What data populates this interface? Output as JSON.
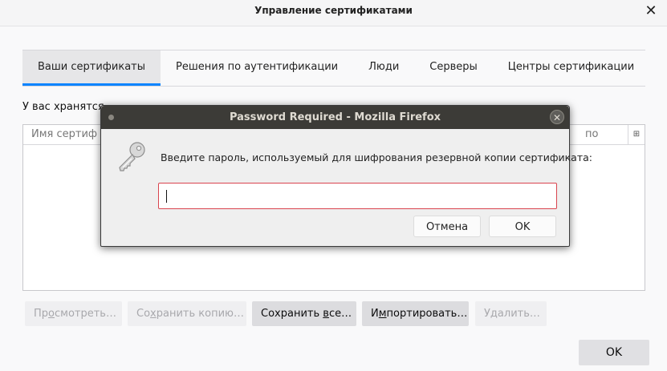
{
  "window": {
    "title": "Управление сертификатами",
    "close_symbol": "✕"
  },
  "tabs": [
    {
      "label": "Ваши сертификаты",
      "active": true
    },
    {
      "label": "Решения по аутентификации",
      "active": false
    },
    {
      "label": "Люди",
      "active": false
    },
    {
      "label": "Серверы",
      "active": false
    },
    {
      "label": "Центры сертификации",
      "active": false
    }
  ],
  "description": "У вас хранятся",
  "tree": {
    "column_name": "Имя сертиф",
    "column_right": "по",
    "picker_symbol": "⊞"
  },
  "buttons": {
    "view": {
      "pre": "Пр",
      "u": "о",
      "post": "смотреть…"
    },
    "backup": {
      "pre": "Со",
      "u": "х",
      "post": "ранить копию…"
    },
    "backup_all": {
      "pre": "Сохранить ",
      "u": "в",
      "post": "се…"
    },
    "import": {
      "pre": "И",
      "u": "м",
      "post": "портировать…"
    },
    "delete": {
      "pre": "У",
      "u": "д",
      "post": "алить…"
    },
    "ok": "OK"
  },
  "dialog": {
    "title": "Password Required - Mozilla Firefox",
    "close_symbol": "✕",
    "message": "Введите пароль, используемый для шифрования резервной копии сертификата:",
    "input_value": "",
    "cancel_label": "Отмена",
    "ok_label": "OK",
    "icon": "key-icon"
  },
  "colors": {
    "accent": "#0a84ff",
    "dialog_titlebar": "#3c3b37",
    "input_error_border": "#d9444e"
  }
}
